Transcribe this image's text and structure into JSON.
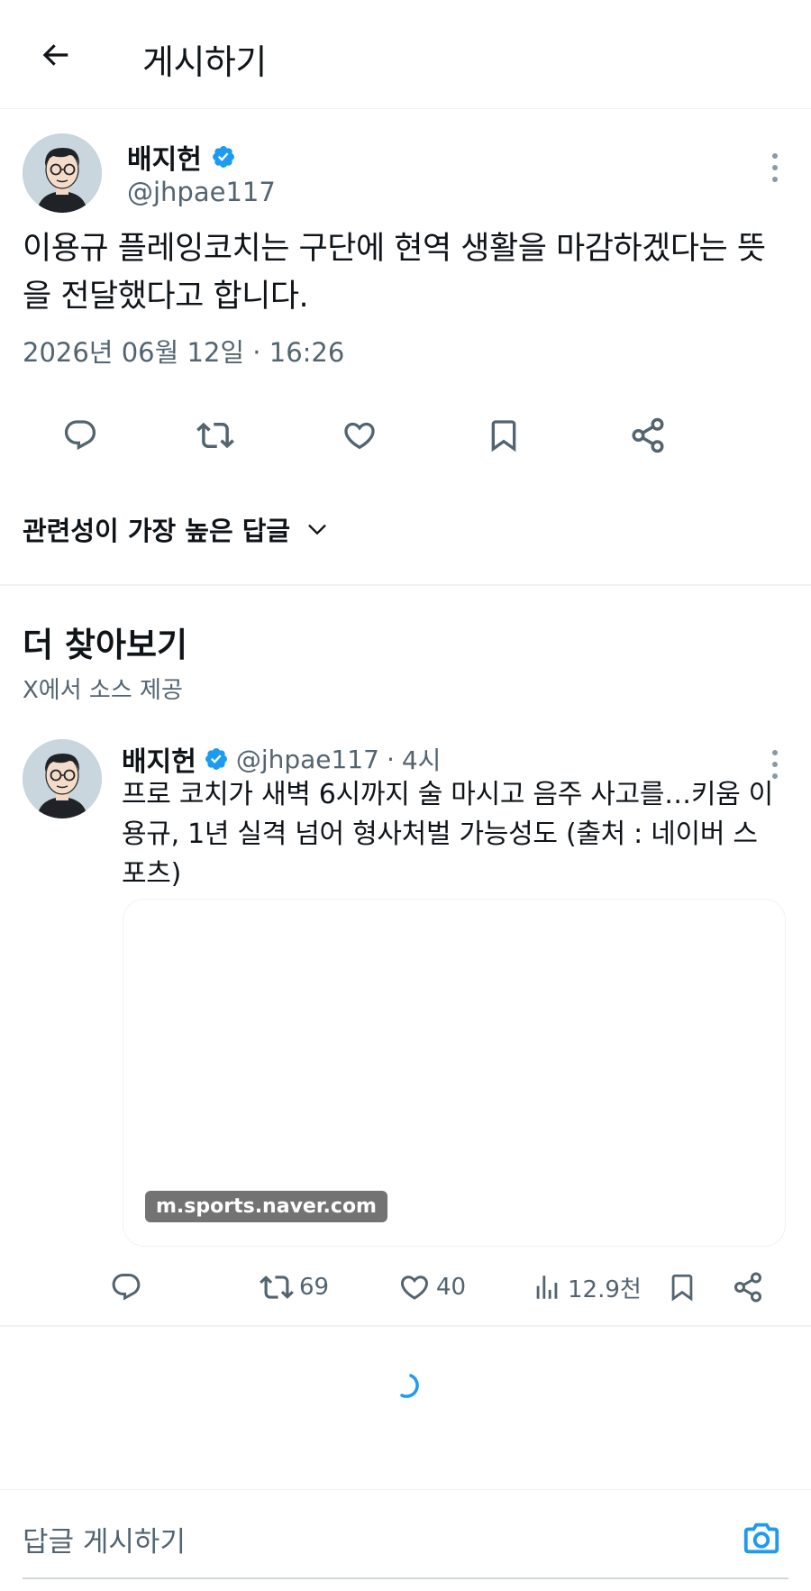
{
  "header": {
    "title": "게시하기"
  },
  "post": {
    "author_name": "배지헌",
    "author_handle": "@jhpae117",
    "text": "이용규 플레잉코치는 구단에 현역 생활을 마감하겠다는 뜻을 전달했다고 합니다.",
    "timestamp": "2026년 06월 12일 · 16:26"
  },
  "replies_sort": {
    "label": "관련성이 가장 높은 답글"
  },
  "discover": {
    "title": "더 찾아보기",
    "subtitle": "X에서 소스 제공"
  },
  "related_post": {
    "author_name": "배지헌",
    "author_handle": "@jhpae117",
    "dot": "·",
    "time": "4시",
    "text": "프로 코치가 새벽 6시까지 술 마시고 음주 사고를…키움 이용규, 1년 실격 넘어 형사처벌 가능성도 (출처 : 네이버 스포츠)",
    "card_domain": "m.sports.naver.com",
    "retweets": "69",
    "likes": "40",
    "views": "12.9천"
  },
  "reply_box": {
    "placeholder": "답글 게시하기"
  },
  "colors": {
    "accent": "#1d9bf0",
    "text_secondary": "#536471",
    "icon": "#536471"
  }
}
